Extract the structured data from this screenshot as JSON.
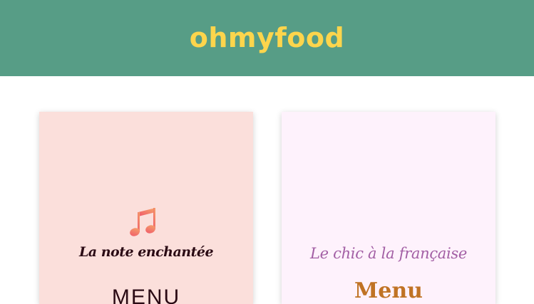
{
  "header": {
    "logo_text": "ohmyfood"
  },
  "cards": [
    {
      "title": "La note enchantée",
      "menu_label": "MENU",
      "icon": "music-notes-icon",
      "colors": {
        "background": "#fbdfdb",
        "text": "#2a0a14",
        "icon_start": "#f0556a",
        "icon_end": "#f5a86a"
      }
    },
    {
      "title": "Le chic à la française",
      "menu_label": "Menu",
      "colors": {
        "background": "#fef2fc",
        "title": "#a25ea4",
        "menu": "#c07325"
      }
    }
  ],
  "colors": {
    "header_bg": "#579d86",
    "logo": "#fdd54c"
  }
}
